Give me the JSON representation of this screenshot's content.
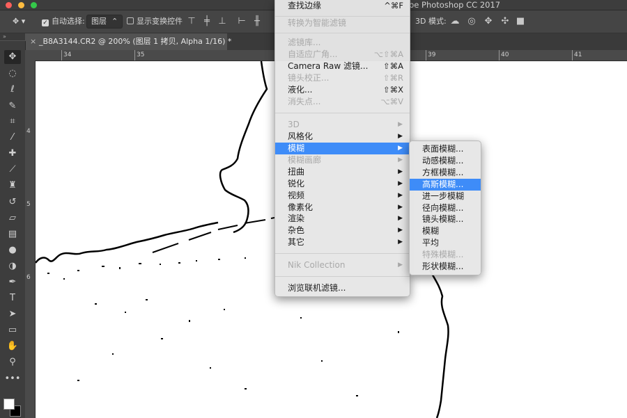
{
  "app_title": "be Photoshop CC 2017",
  "options_bar": {
    "auto_select_label": "自动选择:",
    "auto_select_value": "图层",
    "show_transform_label": "显示变换控件",
    "mode_3d_label": "3D 模式:"
  },
  "document_tab": {
    "title": "_B8A3144.CR2 @ 200% (图层 1 拷贝, Alpha 1/16) *",
    "close_glyph": "×"
  },
  "ruler": {
    "horizontal_numbers": [
      "34",
      "35",
      "39",
      "40",
      "41"
    ],
    "vertical_numbers": [
      "4",
      "5",
      "6"
    ]
  },
  "filter_menu": {
    "items": [
      {
        "label": "查找边缘",
        "shortcut": "^⌘F",
        "disabled": false
      },
      {
        "label": "转换为智能滤镜",
        "shortcut": "",
        "disabled": true
      },
      {
        "label": "滤镜库...",
        "shortcut": "",
        "disabled": true
      },
      {
        "label": "自适应广角...",
        "shortcut": "⌥⇧⌘A",
        "disabled": true
      },
      {
        "label": "Camera Raw 滤镜...",
        "shortcut": "⇧⌘A",
        "disabled": false
      },
      {
        "label": "镜头校正...",
        "shortcut": "⇧⌘R",
        "disabled": true
      },
      {
        "label": "液化...",
        "shortcut": "⇧⌘X",
        "disabled": false
      },
      {
        "label": "消失点...",
        "shortcut": "⌥⌘V",
        "disabled": true
      },
      {
        "label": "3D",
        "shortcut": "▶",
        "disabled": true
      },
      {
        "label": "风格化",
        "shortcut": "▶",
        "disabled": false
      },
      {
        "label": "模糊",
        "shortcut": "▶",
        "disabled": false,
        "highlighted": true
      },
      {
        "label": "模糊画廊",
        "shortcut": "▶",
        "disabled": true
      },
      {
        "label": "扭曲",
        "shortcut": "▶",
        "disabled": false
      },
      {
        "label": "锐化",
        "shortcut": "▶",
        "disabled": false
      },
      {
        "label": "视频",
        "shortcut": "▶",
        "disabled": false
      },
      {
        "label": "像素化",
        "shortcut": "▶",
        "disabled": false
      },
      {
        "label": "渲染",
        "shortcut": "▶",
        "disabled": false
      },
      {
        "label": "杂色",
        "shortcut": "▶",
        "disabled": false
      },
      {
        "label": "其它",
        "shortcut": "▶",
        "disabled": false
      },
      {
        "label": "Nik Collection",
        "shortcut": "▶",
        "disabled": true
      },
      {
        "label": "浏览联机滤镜...",
        "shortcut": "",
        "disabled": false
      }
    ]
  },
  "blur_submenu": {
    "items": [
      {
        "label": "表面模糊...",
        "disabled": false
      },
      {
        "label": "动感模糊...",
        "disabled": false
      },
      {
        "label": "方框模糊...",
        "disabled": false
      },
      {
        "label": "高斯模糊...",
        "disabled": false,
        "highlighted": true
      },
      {
        "label": "进一步模糊",
        "disabled": false
      },
      {
        "label": "径向模糊...",
        "disabled": false
      },
      {
        "label": "镜头模糊...",
        "disabled": false
      },
      {
        "label": "模糊",
        "disabled": false
      },
      {
        "label": "平均",
        "disabled": false
      },
      {
        "label": "特殊模糊...",
        "disabled": true
      },
      {
        "label": "形状模糊...",
        "disabled": false
      }
    ]
  },
  "toolbar_icons": [
    "move-icon",
    "marquee-icon",
    "lasso-icon",
    "quick-select-icon",
    "crop-icon",
    "eyedropper-icon",
    "healing-brush-icon",
    "brush-icon",
    "clone-stamp-icon",
    "history-brush-icon",
    "eraser-icon",
    "gradient-icon",
    "blur-icon",
    "dodge-icon",
    "pen-icon",
    "type-icon",
    "path-select-icon",
    "rectangle-icon",
    "hand-icon",
    "zoom-icon",
    "more-icon"
  ],
  "colors": {
    "highlight": "#3e8cf8",
    "foreground": "#ffffff",
    "background": "#000000"
  }
}
